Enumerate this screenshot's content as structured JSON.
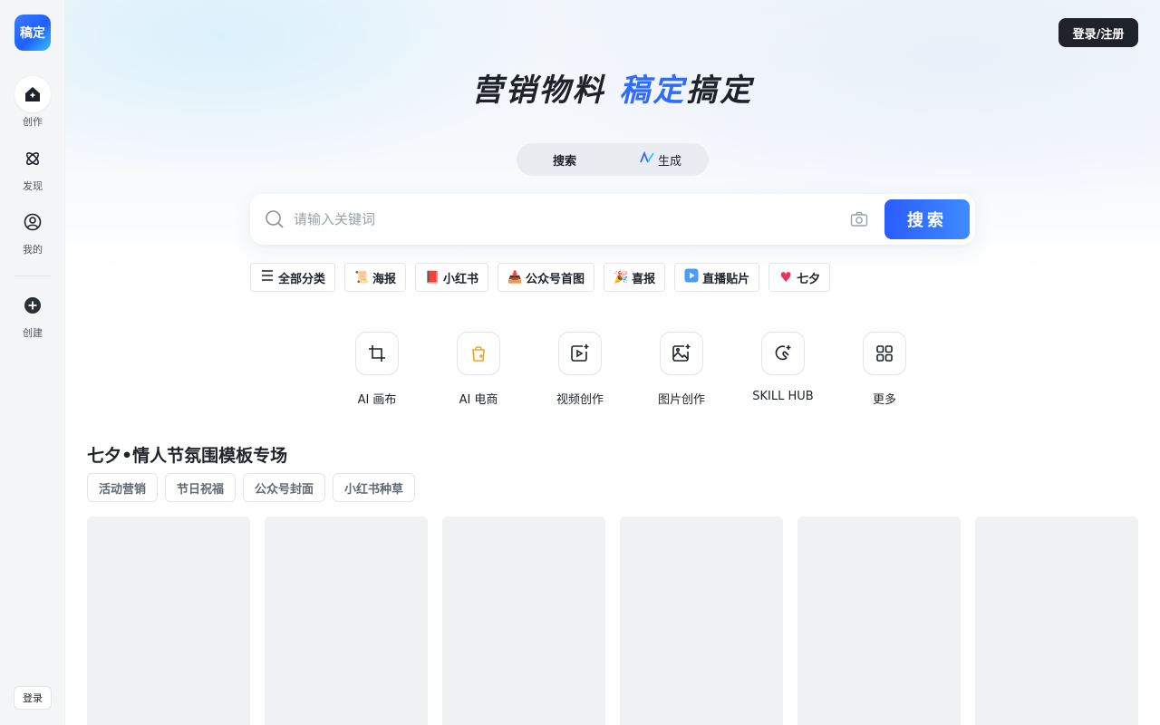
{
  "sidebar": {
    "logo_text": "稿定",
    "items": [
      {
        "label": "创作",
        "icon": "home-icon",
        "active": true
      },
      {
        "label": "发现",
        "icon": "orbit-icon",
        "active": false
      },
      {
        "label": "我的",
        "icon": "user-icon",
        "active": false
      },
      {
        "label": "创建",
        "icon": "plus-circle-icon",
        "active": false
      }
    ],
    "login_label": "登录"
  },
  "header": {
    "login_register_label": "登录/注册"
  },
  "hero": {
    "title_part1": "营销物料 ",
    "title_accent": "稿定",
    "title_part2": "搞定",
    "accent_color": "#2f6bff"
  },
  "mode_toggle": {
    "search_label": "搜索",
    "generate_label": "生成",
    "active": "search"
  },
  "search": {
    "placeholder": "请输入关键词",
    "value": "",
    "button_label": "搜索",
    "button_color": "#2a5cff"
  },
  "chips": [
    {
      "label": "全部分类",
      "icon": "menu-icon",
      "glyph": ""
    },
    {
      "label": "海报",
      "icon": "scroll-icon",
      "glyph": "📜"
    },
    {
      "label": "小红书",
      "icon": "notebook-icon",
      "glyph": "📕"
    },
    {
      "label": "公众号首图",
      "icon": "inbox-icon",
      "glyph": "📥"
    },
    {
      "label": "喜报",
      "icon": "party-popper-icon",
      "glyph": "🎉"
    },
    {
      "label": "直播贴片",
      "icon": "play-button-icon",
      "glyph": "▶"
    },
    {
      "label": "七夕",
      "icon": "heart-icon",
      "glyph": "♥"
    }
  ],
  "tools": [
    {
      "label": "AI 画布",
      "icon": "crop-frame-icon"
    },
    {
      "label": "AI 电商",
      "icon": "shopping-bag-icon"
    },
    {
      "label": "视频创作",
      "icon": "video-sparkle-icon"
    },
    {
      "label": "图片创作",
      "icon": "image-sparkle-icon"
    },
    {
      "label": "SKILL HUB",
      "icon": "skill-sparkle-icon"
    },
    {
      "label": "更多",
      "icon": "grid-icon"
    }
  ],
  "section": {
    "title": "七夕•情人节氛围模板专场",
    "tags": [
      "活动营销",
      "节日祝福",
      "公众号封面",
      "小红书种草"
    ]
  }
}
